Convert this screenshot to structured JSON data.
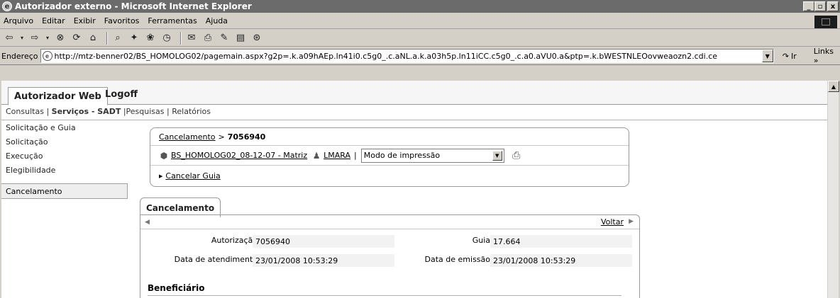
{
  "window": {
    "title": "Autorizador externo - Microsoft Internet Explorer",
    "buttons": [
      "_",
      "▫",
      "x"
    ]
  },
  "menu": [
    "Arquivo",
    "Editar",
    "Exibir",
    "Favoritos",
    "Ferramentas",
    "Ajuda"
  ],
  "address": {
    "label": "Endereço",
    "url": "http://mtz-benner02/BS_HOMOLOG02/pagemain.aspx?g2p=.k.a09hAEp.ln41i0.c5g0_.c.aNL.a.k.a03h5p.ln11iCC.c5g0_.c.a0.aVU0.a&ptp=.k.bWESTNLEOovweaozn2.cdi.ce",
    "go_label": "Ir",
    "links_label": "Links »"
  },
  "app": {
    "tab_active": "Autorizador Web",
    "tab_logoff": "Logoff",
    "subnav": {
      "item1": "Consultas",
      "item2": "Serviços - SADT",
      "item3": "Pesquisas",
      "item4": "Relatórios",
      "sep": "|"
    },
    "sidebar": [
      "Solicitação e Guia",
      "Solicitação",
      "Execução",
      "Elegibilidade",
      "Cancelamento"
    ],
    "breadcrumb": {
      "link": "Cancelamento",
      "sep": ">",
      "current": "7056940"
    },
    "context": {
      "company": "BS_HOMOLOG02_08-12-07 - Matriz",
      "user": "LMARA",
      "sep": "|",
      "print_mode": "Modo de impressão"
    },
    "action_link": "Cancelar Guia",
    "panel_tab": "Cancelamento",
    "voltar": "Voltar",
    "fields": {
      "autorizacao_label": "Autorização",
      "autorizacao_value": "7056940",
      "guia_label": "Guia",
      "guia_value": "17.664",
      "data_atendimento_label": "Data de atendimento",
      "data_atendimento_value": "23/01/2008 10:53:29",
      "data_emissao_label": "Data de emissão",
      "data_emissao_value": "23/01/2008 10:53:29"
    },
    "section_beneficiario": "Beneficiário"
  },
  "icons": {
    "back": "back-arrow-icon",
    "forward": "forward-arrow-icon",
    "stop": "stop-icon",
    "refresh": "refresh-icon",
    "home": "home-icon",
    "search": "search-icon",
    "favorites": "favorites-icon",
    "history": "history-icon",
    "media": "media-icon",
    "edit": "edit-icon",
    "print": "printer-icon",
    "mail": "mail-icon",
    "discuss": "discuss-icon",
    "messenger": "messenger-icon"
  }
}
